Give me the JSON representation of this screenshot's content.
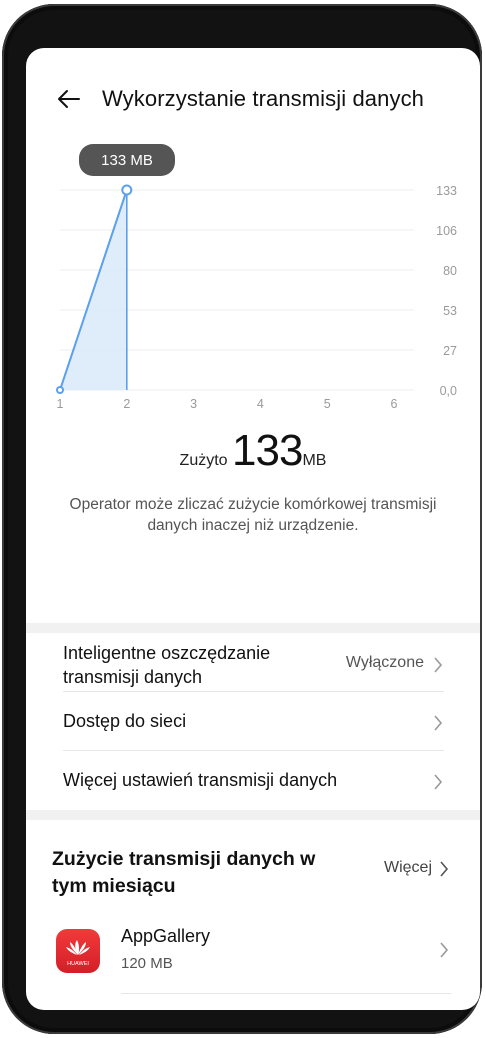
{
  "header": {
    "title": "Wykorzystanie transmisji danych"
  },
  "chart_data": {
    "type": "line",
    "x": [
      1,
      2
    ],
    "values": [
      0,
      133
    ],
    "x_ticks": [
      "1",
      "2",
      "3",
      "4",
      "5",
      "6"
    ],
    "y_ticks": [
      "0,0",
      "27",
      "53",
      "80",
      "106",
      "133"
    ],
    "ylim": [
      0,
      133
    ],
    "xlim": [
      1,
      6
    ],
    "tooltip": "133 MB",
    "colors": {
      "line": "#5aa0ec",
      "fill": "#dcebfb",
      "grid": "#ececec",
      "tick": "#9a9a9a"
    }
  },
  "usage": {
    "label": "Zużyto",
    "value": "133",
    "unit": "MB"
  },
  "note": "Operator może zliczać zużycie komórkowej transmisji danych inaczej niż urządzenie.",
  "settings": [
    {
      "label": "Inteligentne oszczędzanie transmisji danych",
      "value": "Wyłączone"
    },
    {
      "label": "Dostęp do sieci",
      "value": ""
    },
    {
      "label": "Więcej ustawień transmisji danych",
      "value": ""
    }
  ],
  "monthly": {
    "title": "Zużycie transmisji danych w tym miesiącu",
    "more": "Więcej",
    "apps": [
      {
        "name": "AppGallery",
        "size": "120 MB",
        "icon": "huawei-appgallery-icon",
        "icon_text": "HUAWEI"
      }
    ]
  }
}
